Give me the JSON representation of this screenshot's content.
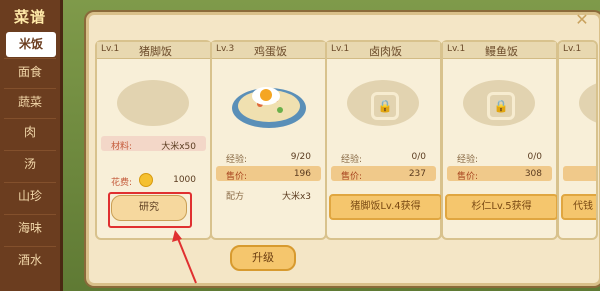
{
  "sidebar": {
    "title": "菜谱",
    "items": [
      "米饭",
      "面食",
      "蔬菜",
      "肉",
      "汤",
      "山珍",
      "海味",
      "酒水"
    ]
  },
  "cards": [
    {
      "level": "Lv.1",
      "name": "猪脚饭",
      "material_label": "材料:",
      "material_value": "大米x50",
      "cost_label": "花费:",
      "cost_value": "1000",
      "button": "研究"
    },
    {
      "level": "Lv.3",
      "name": "鸡蛋饭",
      "exp_label": "经验:",
      "exp_value": "9/20",
      "price_label": "售价:",
      "price_value": "196",
      "recipe_label": "配方",
      "recipe_value": "大米x3"
    },
    {
      "level": "Lv.1",
      "name": "卤肉饭",
      "exp_label": "经验:",
      "exp_value": "0/0",
      "price_label": "售价:",
      "price_value": "237",
      "unlock": "猪脚饭Lv.4获得"
    },
    {
      "level": "Lv.1",
      "name": "鳗鱼饭",
      "exp_label": "经验:",
      "exp_value": "0/0",
      "price_label": "售价:",
      "price_value": "308",
      "unlock": "杉仁Lv.5获得"
    },
    {
      "level": "Lv.1",
      "name": "",
      "exp_label": "",
      "unlock": "代钱"
    }
  ],
  "upgrade_button": "升级",
  "close_icon": "close-icon",
  "colors": {
    "highlight_red": "#e03030"
  }
}
